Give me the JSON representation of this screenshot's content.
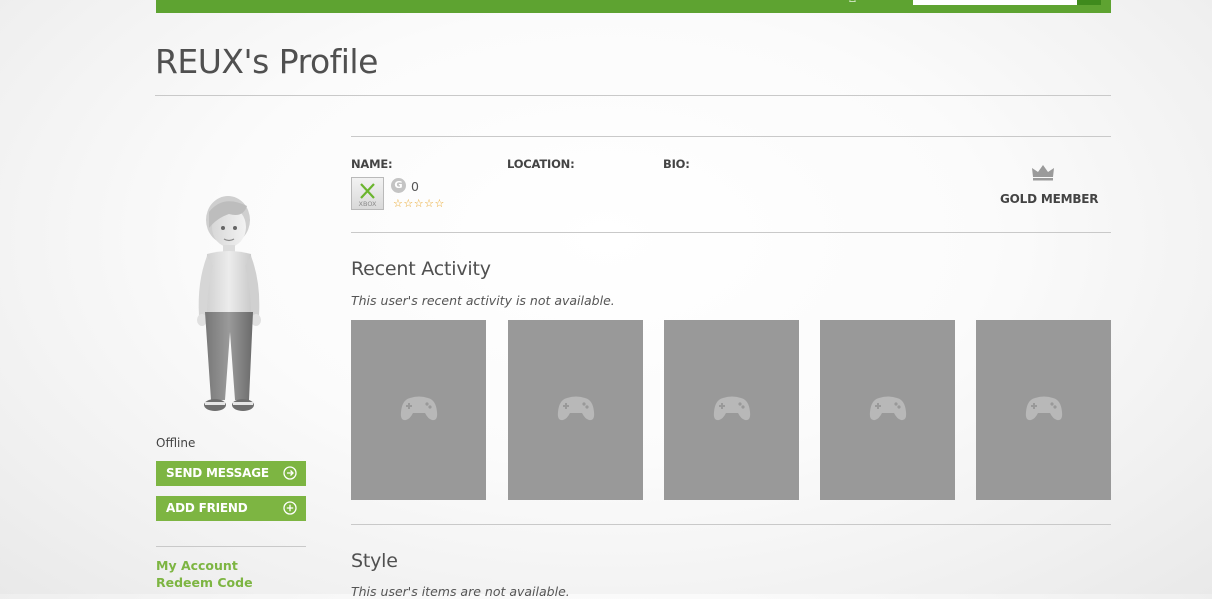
{
  "page": {
    "title": "REUX's Profile"
  },
  "sidebar": {
    "status": "Offline",
    "buttons": {
      "send_message": "SEND MESSAGE",
      "add_friend": "ADD FRIEND"
    },
    "links": {
      "my_account": "My Account",
      "redeem_code": "Redeem Code"
    }
  },
  "profile": {
    "labels": {
      "name": "NAME:",
      "location": "LOCATION:",
      "bio": "BIO:"
    },
    "gamerscore_badge": "G",
    "gamerscore": "0",
    "rating_stars": "☆☆☆☆☆",
    "rating": 0,
    "membership": "GOLD MEMBER",
    "tile_text": "XBOX"
  },
  "recent_activity": {
    "title": "Recent Activity",
    "message": "This user's recent activity is not available.",
    "placeholder_count": 5,
    "placeholder_icon": "controller-icon"
  },
  "style_section": {
    "title": "Style",
    "message": "This user's items are not available."
  },
  "colors": {
    "brand_green": "#5ea331",
    "button_green": "#7db542",
    "placeholder_gray": "#999999",
    "star_orange": "#e8a323"
  }
}
